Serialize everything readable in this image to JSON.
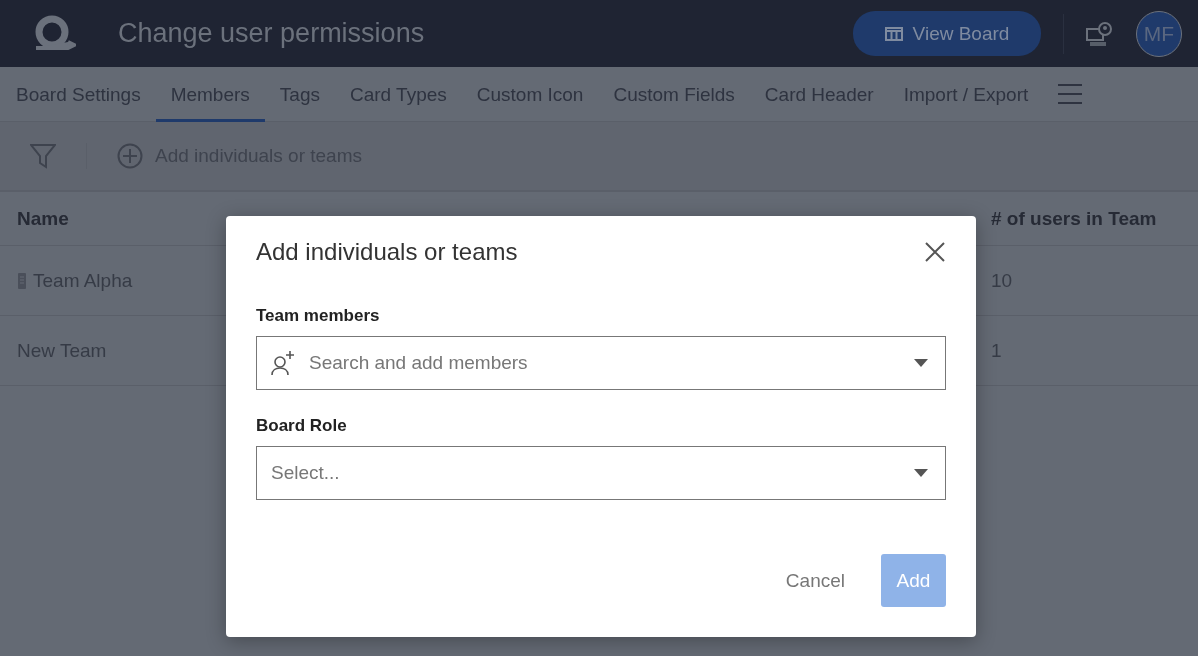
{
  "header": {
    "title": "Change user permissions",
    "view_board": "View Board",
    "avatar": "MF"
  },
  "tabs": [
    {
      "label": "Board Settings",
      "selected": false
    },
    {
      "label": "Members",
      "selected": true
    },
    {
      "label": "Tags",
      "selected": false
    },
    {
      "label": "Card Types",
      "selected": false
    },
    {
      "label": "Custom Icon",
      "selected": false
    },
    {
      "label": "Custom Fields",
      "selected": false
    },
    {
      "label": "Card Header",
      "selected": false
    },
    {
      "label": "Import / Export",
      "selected": false
    }
  ],
  "toolbar": {
    "add": "Add individuals or teams"
  },
  "table": {
    "columns": [
      "Name",
      "# of users in Team"
    ],
    "rows": [
      {
        "name": "Team Alpha",
        "kind": "team-icon",
        "count": "10"
      },
      {
        "name": "New Team",
        "kind": "plain",
        "count": "1"
      }
    ]
  },
  "dialog": {
    "title": "Add individuals or teams",
    "members_label": "Team members",
    "members_placeholder": "Search and add members",
    "role_label": "Board Role",
    "role_placeholder": "Select...",
    "cancel": "Cancel",
    "add": "Add",
    "add_disabled": true
  }
}
